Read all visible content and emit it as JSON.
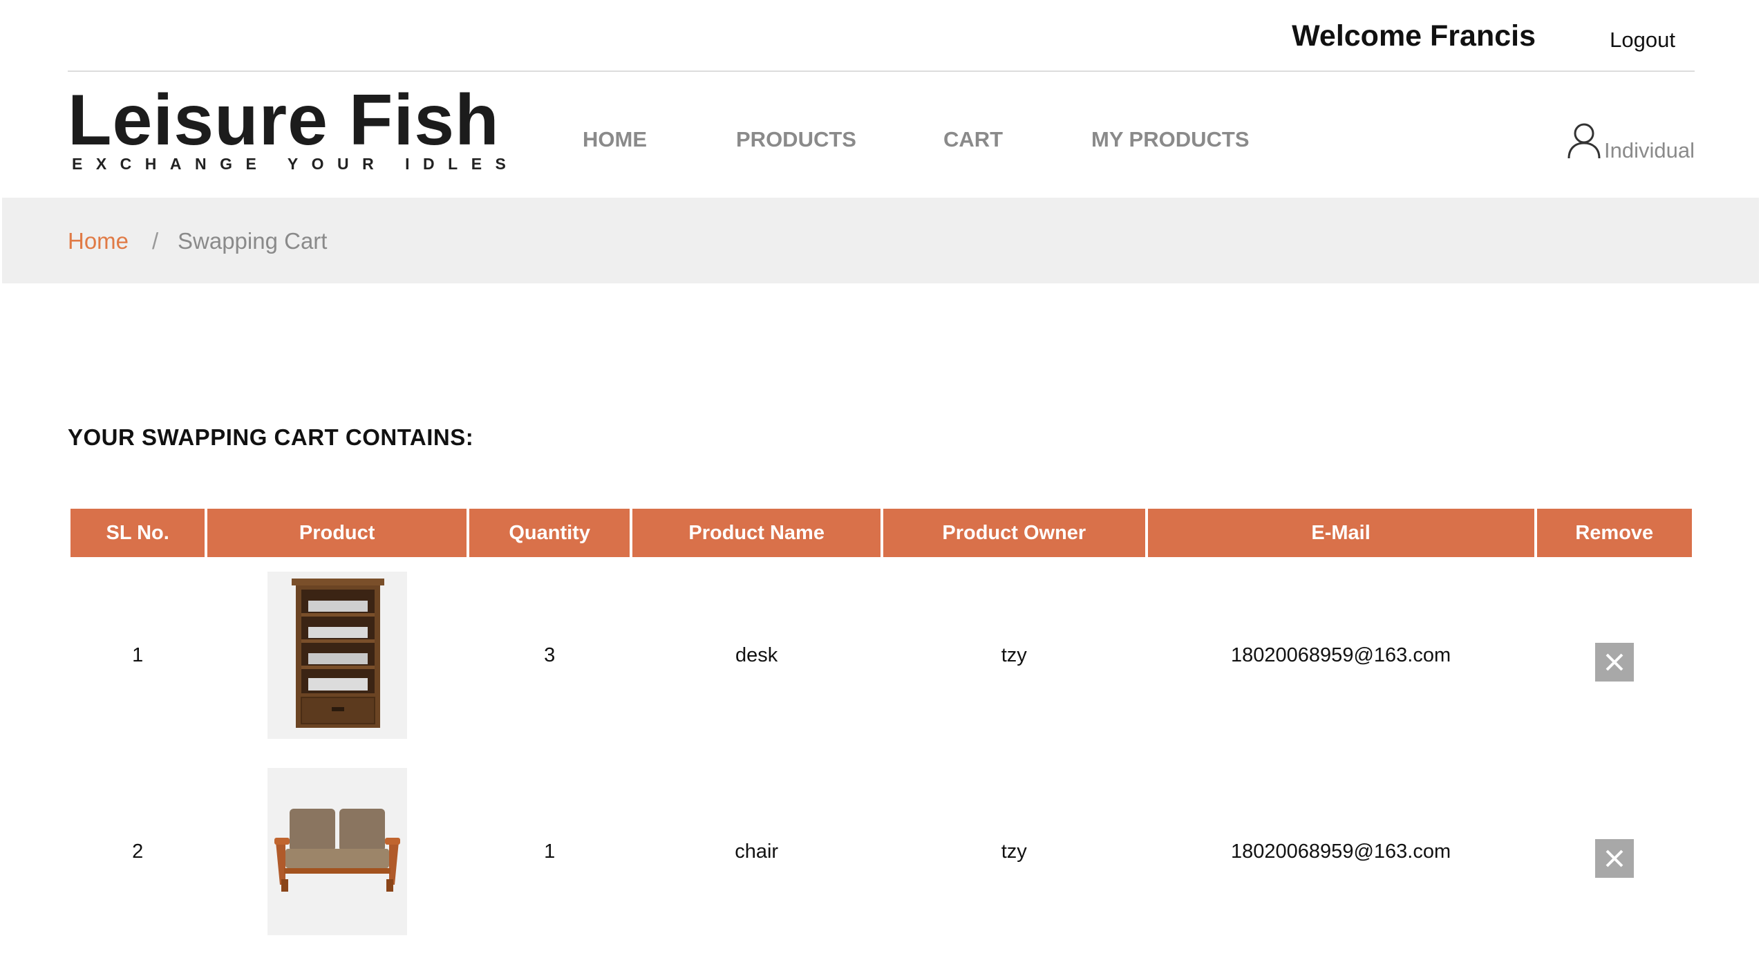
{
  "topbar": {
    "welcome": "Welcome Francis",
    "logout": "Logout"
  },
  "logo": {
    "title": "Leisure Fish",
    "tagline": "EXCHANGE YOUR IDLES"
  },
  "nav": {
    "home": "HOME",
    "products": "PRODUCTS",
    "cart": "CART",
    "my_products": "MY PRODUCTS"
  },
  "user": {
    "label": "Individual",
    "icon": "user-icon"
  },
  "breadcrumb": {
    "home": "Home",
    "separator": "/",
    "current": "Swapping Cart"
  },
  "cart": {
    "heading": "YOUR SWAPPING CART CONTAINS:",
    "columns": [
      "SL No.",
      "Product",
      "Quantity",
      "Product Name",
      "Product Owner",
      "E-Mail",
      "Remove"
    ],
    "rows": [
      {
        "sl": "1",
        "image": "tv-cabinet-image",
        "quantity": "3",
        "name": "desk",
        "owner": "tzy",
        "email": "18020068959@163.com"
      },
      {
        "sl": "2",
        "image": "sofa-image",
        "quantity": "1",
        "name": "chair",
        "owner": "tzy",
        "email": "18020068959@163.com"
      }
    ]
  },
  "colors": {
    "accent": "#d9714a",
    "breadcrumb_link": "#e07a45",
    "nav_text": "#8a8a8a",
    "crumb_bg": "#efefef"
  }
}
